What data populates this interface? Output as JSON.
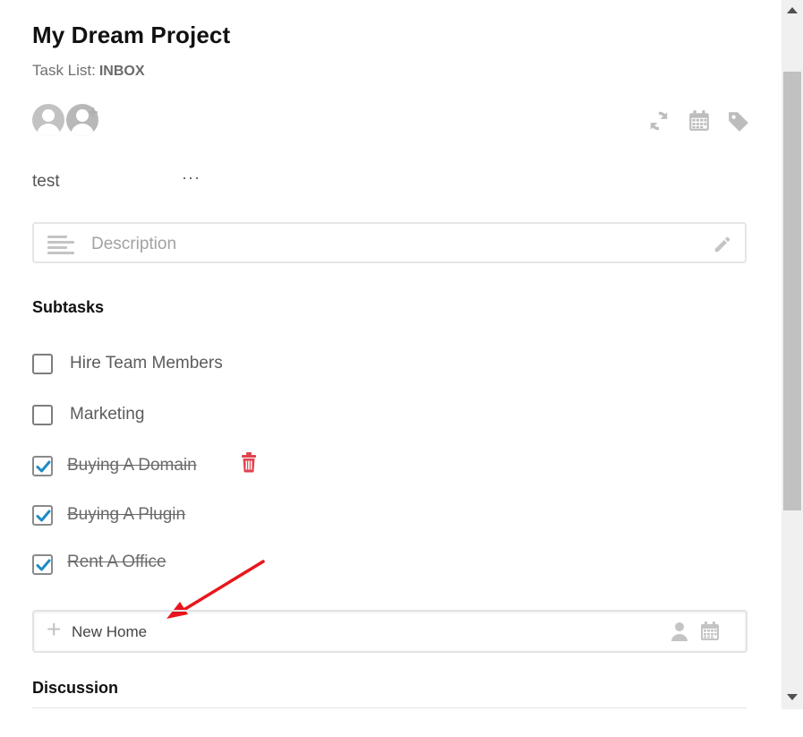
{
  "task": {
    "project_title": "My Dream Project",
    "task_list_label": "Task List:",
    "task_list_value": "INBOX",
    "name": "test",
    "more_label": "···"
  },
  "description": {
    "placeholder": "Description"
  },
  "subtasks": {
    "heading": "Subtasks",
    "items": [
      {
        "label": "Hire Team Members",
        "checked": false
      },
      {
        "label": "Marketing",
        "checked": false
      },
      {
        "label": "Buying A Domain",
        "checked": true
      },
      {
        "label": "Buying A Plugin",
        "checked": true
      },
      {
        "label": "Rent A Office",
        "checked": true
      }
    ]
  },
  "new_subtask": {
    "value": "New Home"
  },
  "discussion": {
    "heading": "Discussion"
  },
  "icons": {
    "repeat": "refresh-icon",
    "due_date": "calendar-icon",
    "tags": "tag-icon",
    "description": "align-left-icon",
    "edit": "pencil-icon",
    "delete": "trash-icon",
    "assignee": "user-icon"
  },
  "colors": {
    "check_accent": "#1e8bc3",
    "delete_accent": "#e0434f",
    "annotation_arrow": "#e8161c"
  }
}
